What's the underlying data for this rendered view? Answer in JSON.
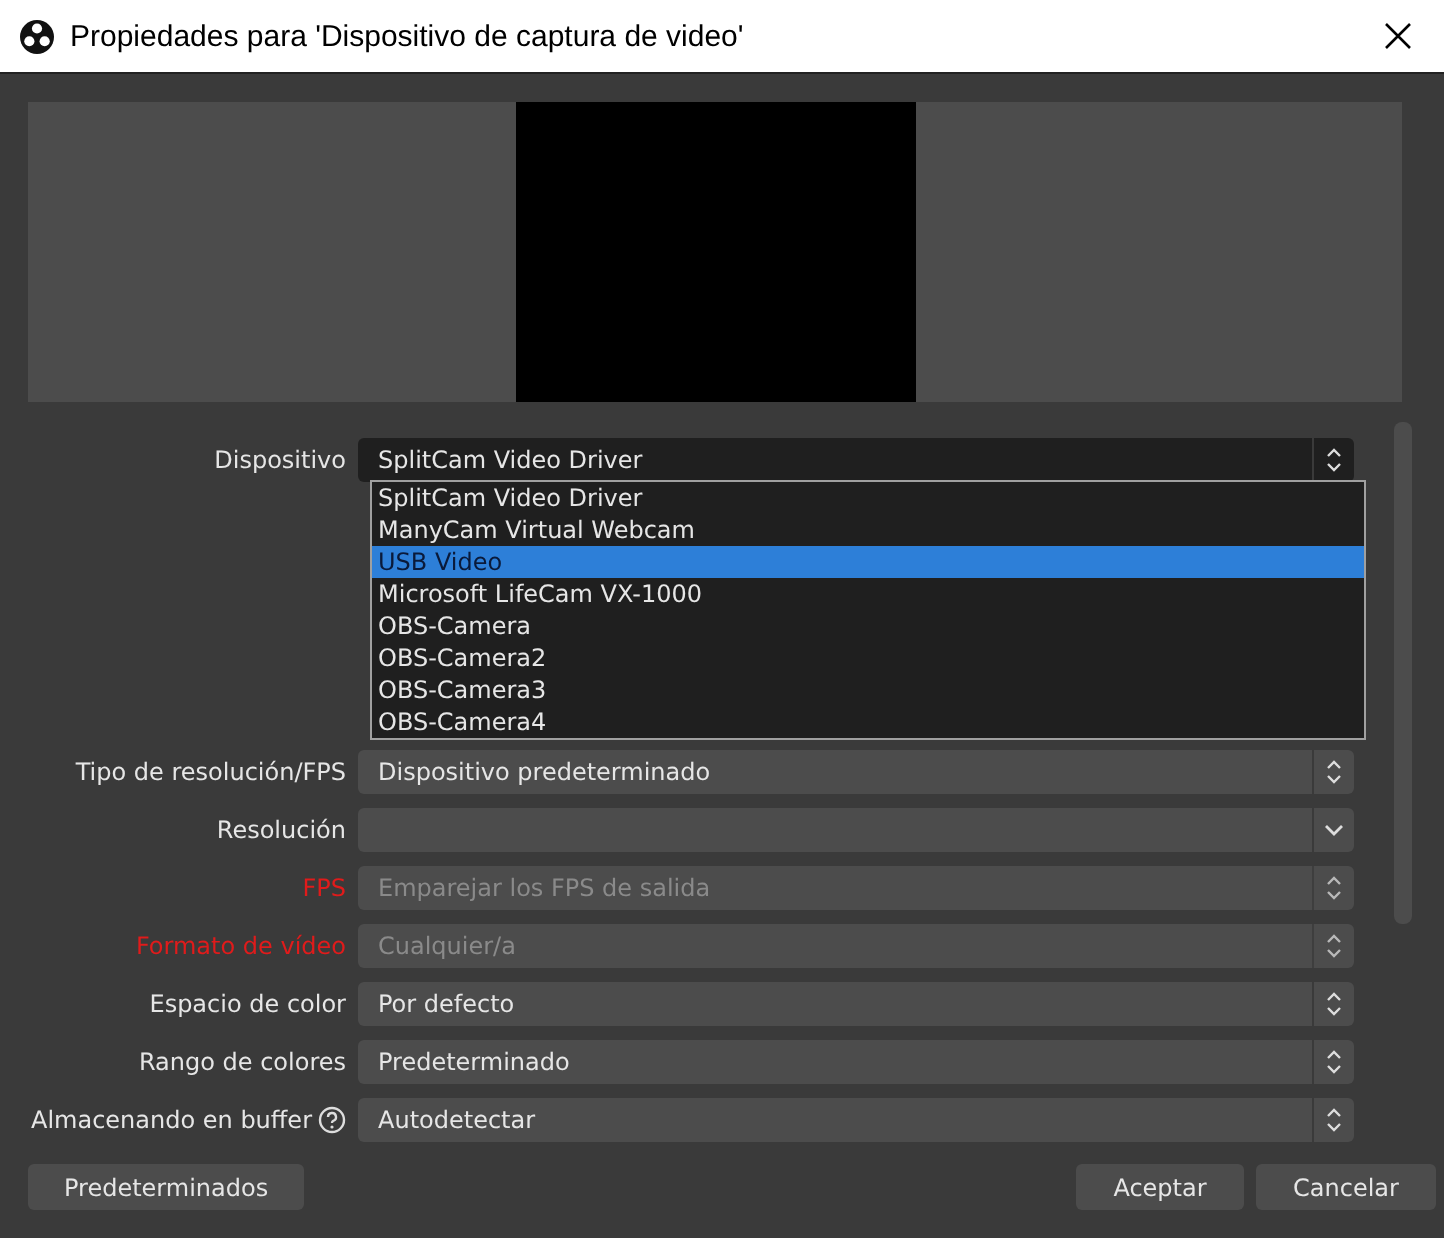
{
  "window": {
    "title": "Propiedades para 'Dispositivo de captura de video'"
  },
  "device": {
    "label": "Dispositivo",
    "value": "SplitCam Video Driver",
    "expanded": true,
    "options": [
      {
        "label": "SplitCam Video Driver",
        "highlighted": false
      },
      {
        "label": "ManyCam Virtual Webcam",
        "highlighted": false
      },
      {
        "label": "USB Video",
        "highlighted": true
      },
      {
        "label": "Microsoft LifeCam VX-1000",
        "highlighted": false
      },
      {
        "label": "OBS-Camera",
        "highlighted": false
      },
      {
        "label": "OBS-Camera2",
        "highlighted": false
      },
      {
        "label": "OBS-Camera3",
        "highlighted": false
      },
      {
        "label": "OBS-Camera4",
        "highlighted": false
      }
    ]
  },
  "fields": [
    {
      "label": "Tipo de resolución/FPS",
      "value": "Dispositivo predeterminado",
      "kind": "spin",
      "disabled": false,
      "warning": false
    },
    {
      "label": "Resolución",
      "kind": "combo",
      "disabled": false,
      "warning": false
    },
    {
      "label": "FPS",
      "value": "Emparejar los FPS de salida",
      "kind": "spin",
      "disabled": true,
      "warning": true
    },
    {
      "label": "Formato de vídeo",
      "value": "Cualquier/a",
      "kind": "spin",
      "disabled": true,
      "warning": true
    },
    {
      "label": "Espacio de color",
      "value": "Por defecto",
      "kind": "spin",
      "disabled": false,
      "warning": false
    },
    {
      "label": "Rango de colores",
      "value": "Predeterminado",
      "kind": "spin",
      "disabled": false,
      "warning": false
    },
    {
      "label": "Almacenando en buffer",
      "value": "Autodetectar",
      "kind": "spin",
      "disabled": false,
      "warning": false,
      "help": true
    }
  ],
  "buttons": {
    "left": [
      "Predeterminados"
    ],
    "right": [
      "Aceptar",
      "Cancelar"
    ]
  }
}
